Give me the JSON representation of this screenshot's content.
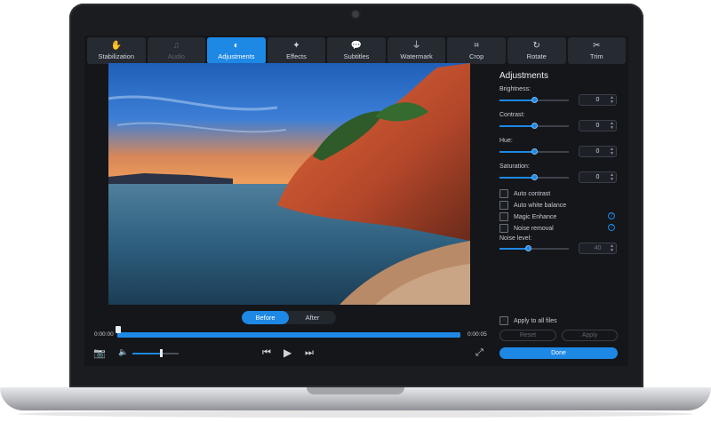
{
  "toolbar": {
    "tabs": [
      {
        "label": "Stabilization",
        "icon": "stabilization-icon"
      },
      {
        "label": "Audio",
        "icon": "music-note-icon"
      },
      {
        "label": "Adjustments",
        "icon": "aperture-icon"
      },
      {
        "label": "Effects",
        "icon": "magic-wand-icon"
      },
      {
        "label": "Subtitles",
        "icon": "speech-bubble-icon"
      },
      {
        "label": "Watermark",
        "icon": "stamp-icon"
      },
      {
        "label": "Crop",
        "icon": "crop-icon"
      },
      {
        "label": "Rotate",
        "icon": "rotate-icon"
      },
      {
        "label": "Trim",
        "icon": "scissors-icon"
      }
    ],
    "active_tab": "Adjustments",
    "disabled_tab": "Audio"
  },
  "preview": {
    "before_label": "Before",
    "after_label": "After",
    "selected": "Before"
  },
  "timeline": {
    "start_time": "0:00:00",
    "end_time": "0:00:05"
  },
  "volume": {
    "level": 0.62
  },
  "adjustments": {
    "title": "Adjustments",
    "brightness": {
      "label": "Brightness:",
      "value": "0"
    },
    "contrast": {
      "label": "Contrast:",
      "value": "0"
    },
    "hue": {
      "label": "Hue:",
      "value": "0"
    },
    "saturation": {
      "label": "Saturation:",
      "value": "0"
    },
    "auto_contrast": "Auto contrast",
    "auto_white_balance": "Auto white balance",
    "magic_enhance": "Magic Enhance",
    "noise_removal": "Noise removal",
    "noise_level_label": "Noise level:",
    "noise_level_value": "40",
    "apply_all": "Apply to all files",
    "reset": "Reset",
    "apply": "Apply",
    "done": "Done"
  },
  "colors": {
    "accent": "#1e88e5",
    "panel_bg": "#14161a"
  }
}
